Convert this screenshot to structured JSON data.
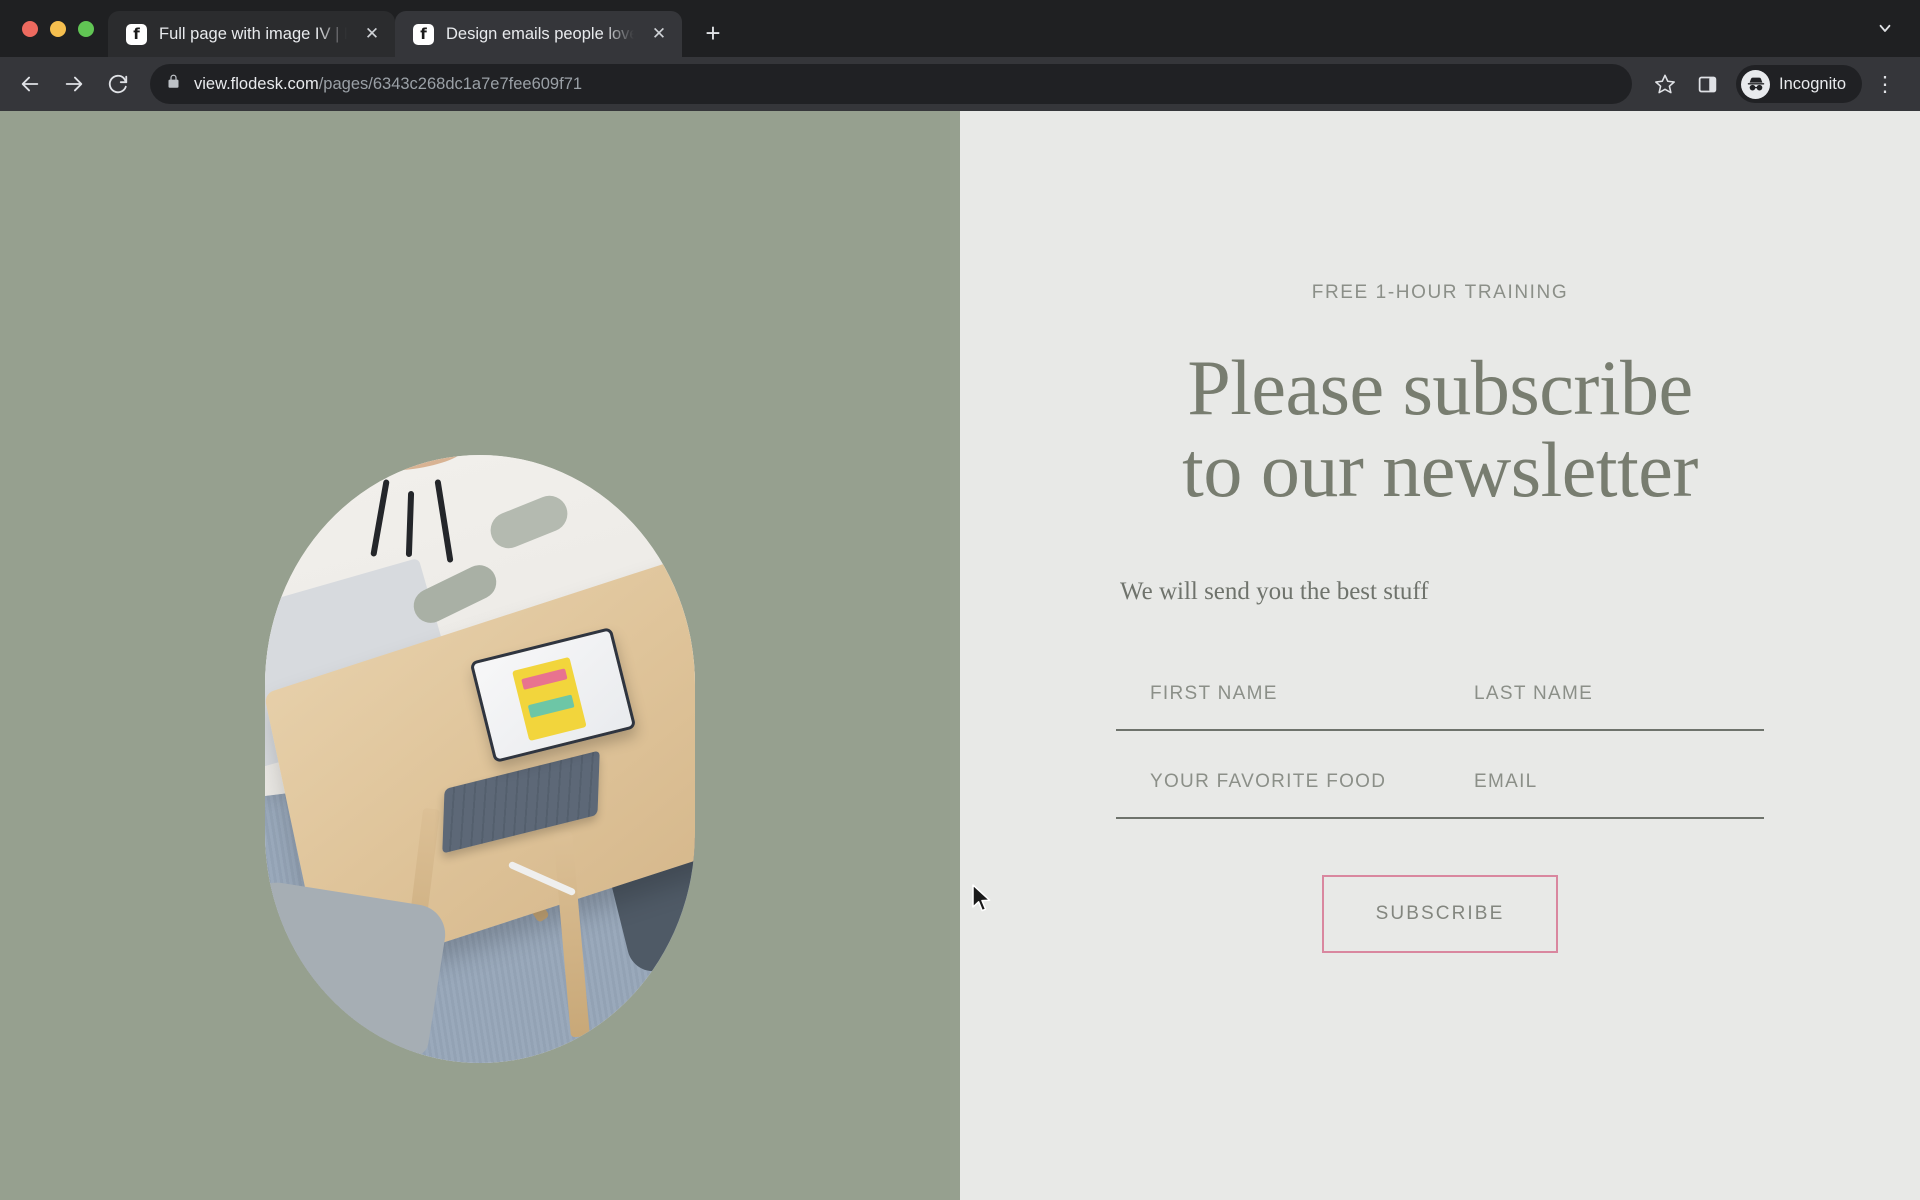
{
  "browser": {
    "window_controls": [
      {
        "name": "close",
        "color": "#ed6a5f"
      },
      {
        "name": "minimize",
        "color": "#f5bf4f"
      },
      {
        "name": "maximize",
        "color": "#61c554"
      }
    ],
    "tabs": [
      {
        "title": "Full page with image IV | Flodesk",
        "favicon_letter": "f",
        "active": false,
        "close_label": "✕"
      },
      {
        "title": "Design emails people love to g",
        "favicon_letter": "f",
        "active": true,
        "close_label": "✕"
      }
    ],
    "new_tab_label": "+",
    "tab_list_chevron": "∨",
    "toolbar": {
      "back_label": "←",
      "forward_label": "→",
      "reload_label": "↻",
      "lock_icon": "lock",
      "url_domain": "view.flodesk.com",
      "url_path": "/pages/6343c268dc1a7e7fee609f71",
      "bookmark_label": "☆",
      "side_panel_label": "side-panel",
      "profile_label": "Incognito",
      "menu_label": "⋮"
    }
  },
  "page": {
    "background_left": "#96a08f",
    "background_right": "#e8e9e7",
    "accent_pink": "#d9879f",
    "text_color": "#787d70",
    "image_alt": "Wooden desk with tablet, keyboard and stylus, grey chairs on a woven rug",
    "eyebrow": "FREE 1-HOUR TRAINING",
    "headline_line1": "Please subscribe",
    "headline_line2": "to our newsletter",
    "subtext": "We will send you the best stuff",
    "fields": [
      {
        "name": "first-name",
        "placeholder": "FIRST NAME",
        "value": ""
      },
      {
        "name": "last-name",
        "placeholder": "LAST NAME",
        "value": ""
      },
      {
        "name": "favorite-food",
        "placeholder": "YOUR FAVORITE FOOD",
        "value": ""
      },
      {
        "name": "email",
        "placeholder": "EMAIL",
        "value": ""
      }
    ],
    "subscribe_label": "SUBSCRIBE"
  }
}
